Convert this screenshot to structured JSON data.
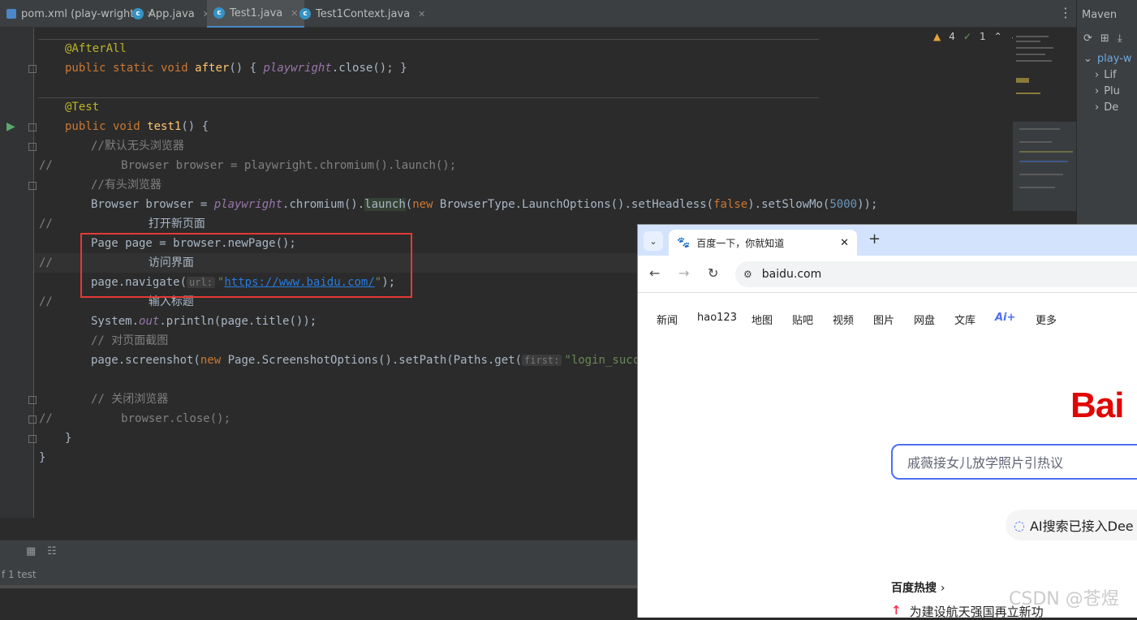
{
  "ide": {
    "tabs": [
      {
        "label": "pom.xml (play-wright)",
        "icon": "maven-icon"
      },
      {
        "label": "App.java",
        "icon": "java-class-icon"
      },
      {
        "label": "Test1.java",
        "icon": "java-class-icon",
        "active": true
      },
      {
        "label": "Test1Context.java",
        "icon": "java-class-icon"
      }
    ],
    "warnings": {
      "warning_count": "4",
      "ok_count": "1"
    },
    "maven": {
      "title": "Maven",
      "items": [
        "play-w",
        "Lif",
        "Plu",
        "De"
      ]
    },
    "status": {
      "test_summary": "f 1 test"
    },
    "code": {
      "l1_annotation": "@AfterAll",
      "l2_kw1": "public static void",
      "l2_method": "after",
      "l2_rest_open": "() {",
      "l2_field": "playwright",
      "l2_call": ".close();",
      "l2_close": "}",
      "l3_annotation": "@Test",
      "l4_kw": "public void",
      "l4_method": "test1",
      "l4_rest": "() {",
      "l5_comment": "//默认无头浏览器",
      "l6_marker": "//",
      "l6_code": "Browser browser = playwright.chromium().launch();",
      "l7_comment": "//有头浏览器",
      "l8_a": "Browser browser = ",
      "l8_field": "playwright",
      "l8_b": ".chromium().",
      "l8_launch": "launch",
      "l8_c": "(",
      "l8_new": "new",
      "l8_d": " BrowserType.LaunchOptions().setHeadless(",
      "l8_false": "false",
      "l8_e": ").setSlowMo(",
      "l8_num": "5000",
      "l8_f": "));",
      "l9_marker": "//",
      "l9_text": "打开新页面",
      "l10_code": "Page page = browser.newPage();",
      "l11_marker": "//",
      "l11_text": "访问界面",
      "l12_a": "page.navigate(",
      "l12_hint": "url:",
      "l12_q1": "\"",
      "l12_url": "https://www.baidu.com/",
      "l12_q2": "\"",
      "l12_end": ");",
      "l13_marker": "//",
      "l13_text": "输入标题",
      "l14_a": "System.",
      "l14_out": "out",
      "l14_b": ".println(page.title());",
      "l15_comment": "// 对页面截图",
      "l16_a": "page.screenshot(",
      "l16_new": "new",
      "l16_b": " Page.ScreenshotOptions().setPath(Paths.get(",
      "l16_hint": "first:",
      "l16_str": "\"login_success.p",
      "l17_comment": "// 关闭浏览器",
      "l18_marker": "//",
      "l18_code": "browser.close();",
      "l19_brace": "}",
      "l20_brace": "}"
    }
  },
  "browser": {
    "tab_title": "百度一下，你就知道",
    "address": "baidu.com",
    "nav_links": [
      "新闻",
      "hao123",
      "地图",
      "贴吧",
      "视频",
      "图片",
      "网盘",
      "文库",
      "Ai+",
      "更多"
    ],
    "logo_text": "Bai",
    "search_placeholder": "戚薇接女儿放学照片引热议",
    "ai_banner": "AI搜索已接入Dee",
    "hot_title": "百度热搜",
    "hot_item": "为建设航天强国再立新功",
    "colors": {
      "brand_red": "#e10601",
      "search_border": "#4e6ef2"
    }
  },
  "watermark": "CSDN @苍煜"
}
